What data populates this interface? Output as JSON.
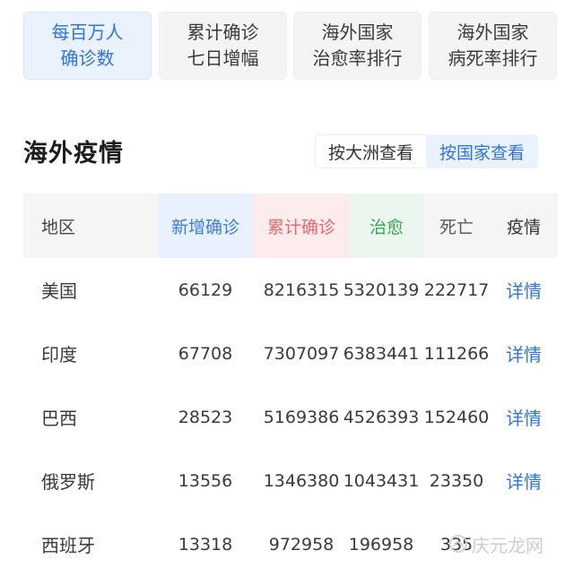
{
  "top_tabs": [
    {
      "line1": "每百万人",
      "line2": "确诊数",
      "active": true
    },
    {
      "line1": "累计确诊",
      "line2": "七日增幅",
      "active": false
    },
    {
      "line1": "海外国家",
      "line2": "治愈率排行",
      "active": false
    },
    {
      "line1": "海外国家",
      "line2": "病死率排行",
      "active": false
    }
  ],
  "section": {
    "title": "海外疫情",
    "view_by_continent": "按大洲查看",
    "view_by_country": "按国家查看"
  },
  "table": {
    "headers": {
      "region": "地区",
      "new": "新增确诊",
      "total": "累计确诊",
      "healed": "治愈",
      "death": "死亡",
      "detail": "疫情"
    },
    "rows": [
      {
        "region": "美国",
        "new": "66129",
        "total": "8216315",
        "healed": "5320139",
        "death": "222717",
        "detail": "详情"
      },
      {
        "region": "印度",
        "new": "67708",
        "total": "7307097",
        "healed": "6383441",
        "death": "111266",
        "detail": "详情"
      },
      {
        "region": "巴西",
        "new": "28523",
        "total": "5169386",
        "healed": "4526393",
        "death": "152460",
        "detail": "详情"
      },
      {
        "region": "俄罗斯",
        "new": "13556",
        "total": "1346380",
        "healed": "1043431",
        "death": "23350",
        "detail": "详情"
      },
      {
        "region": "西班牙",
        "new": "13318",
        "total": "972958",
        "healed": "196958",
        "death": "335",
        "detail": ""
      }
    ]
  },
  "watermark": {
    "text": "庆元龙网"
  },
  "colors": {
    "accent_blue": "#2f74e6",
    "total_red": "#e8686e",
    "heal_green": "#3aa55a"
  }
}
